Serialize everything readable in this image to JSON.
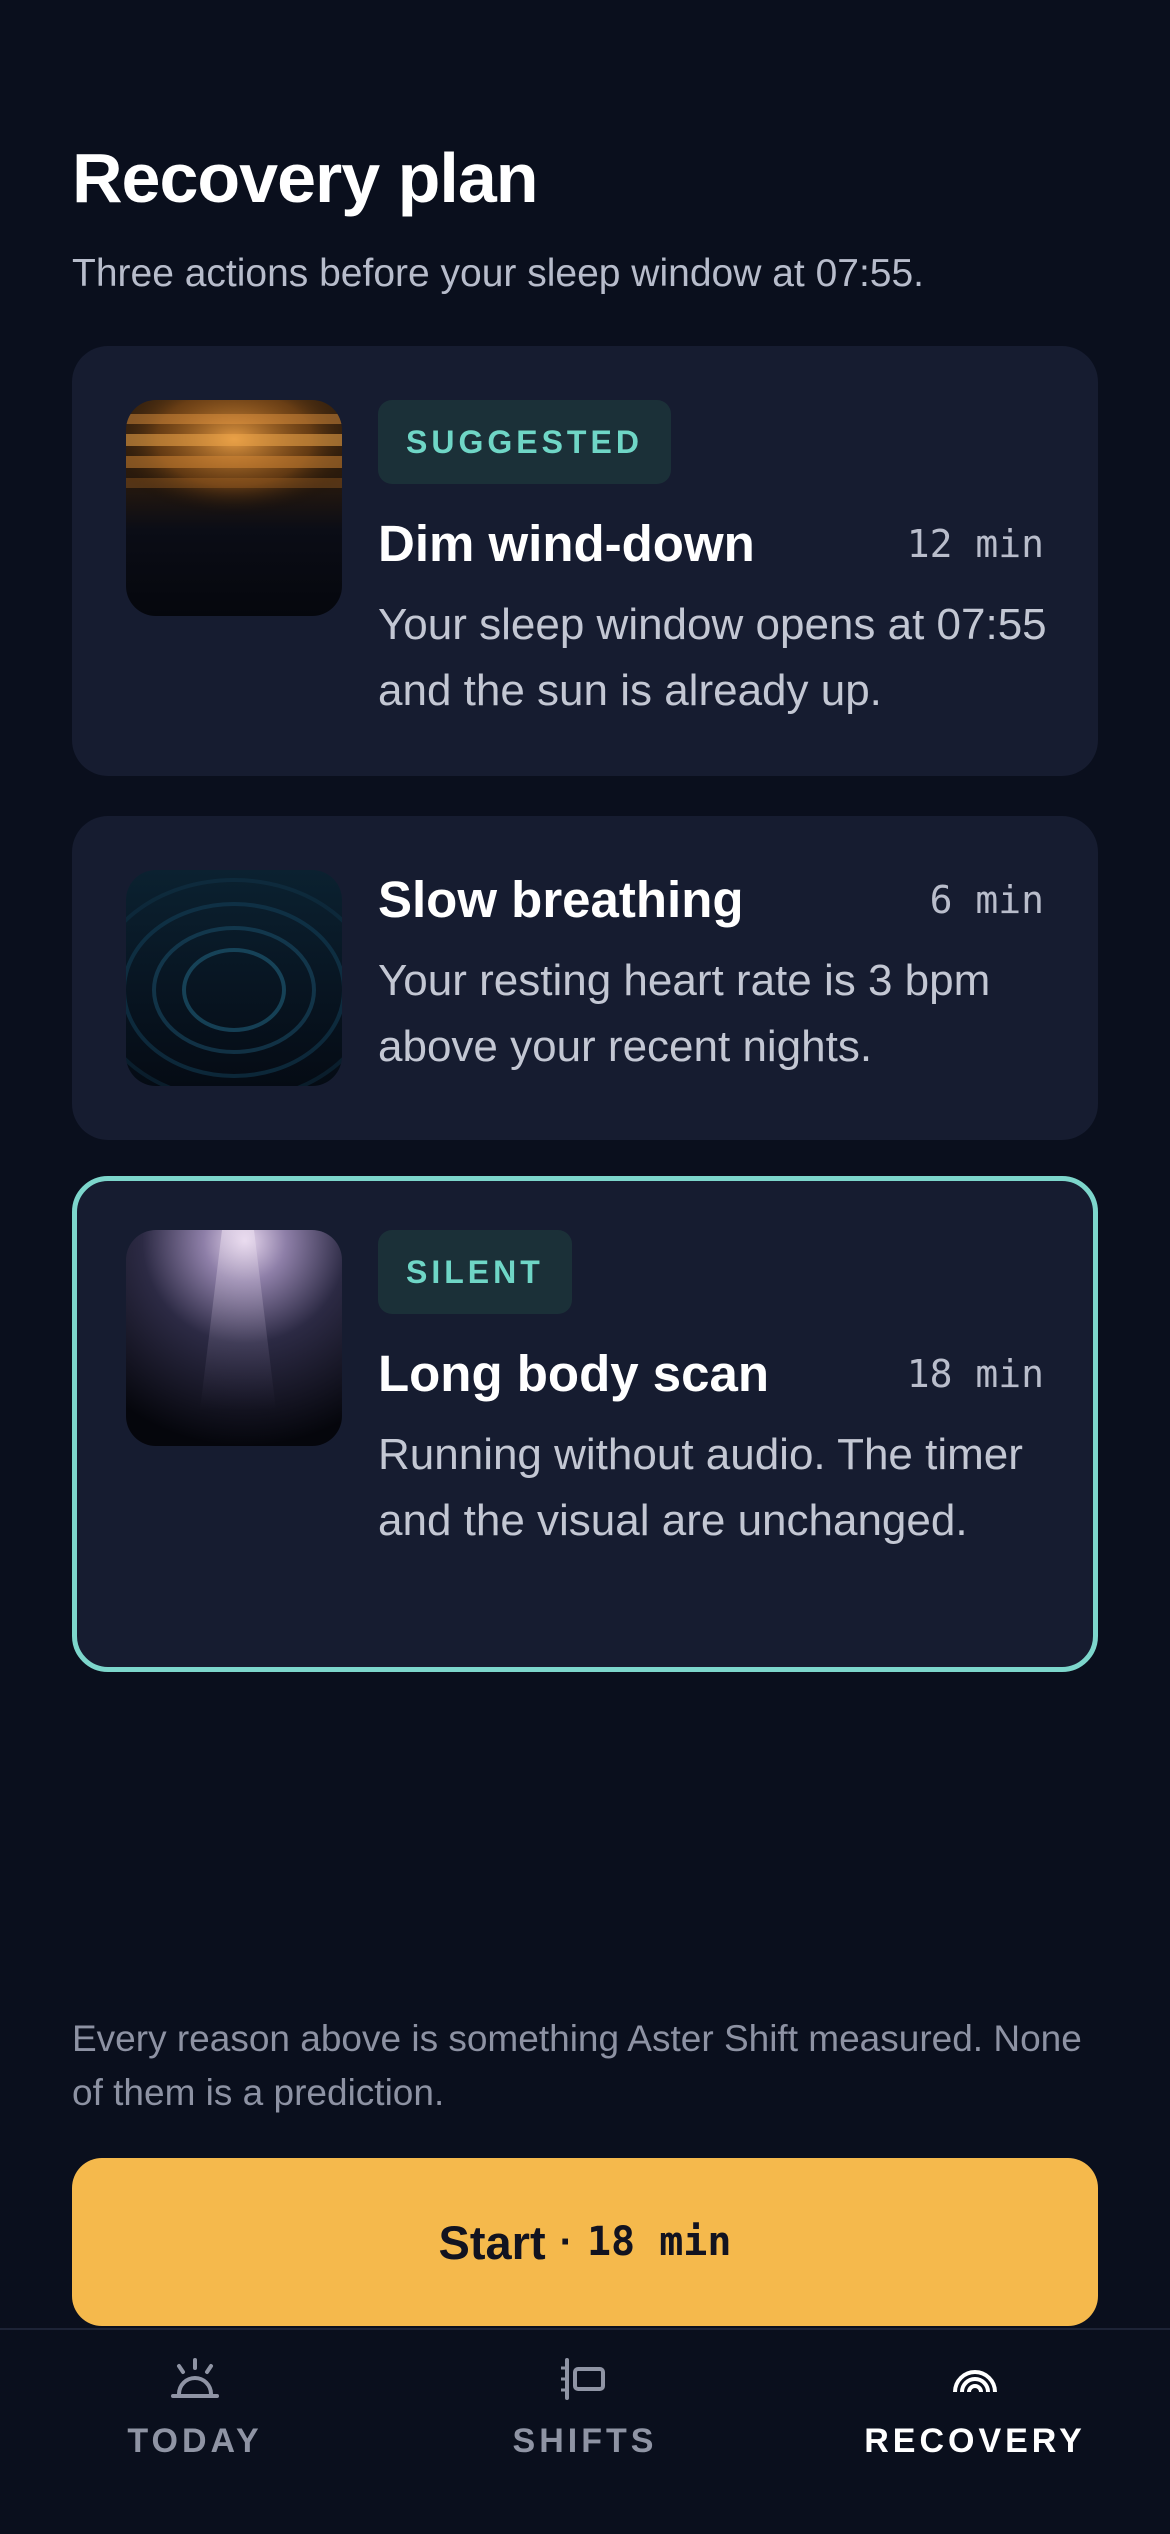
{
  "header": {
    "title": "Recovery plan",
    "subtitle": "Three actions before your sleep window at 07:55."
  },
  "cards": [
    {
      "badge": "SUGGESTED",
      "title": "Dim wind-down",
      "duration": "12 min",
      "description": "Your sleep window opens at 07:55 and the sun is already up.",
      "thumb_icon": "dim-light-thumbnail"
    },
    {
      "title": "Slow breathing",
      "duration": "6 min",
      "description": "Your resting heart rate is 3 bpm above your recent nights.",
      "thumb_icon": "breathing-ripple-thumbnail"
    },
    {
      "badge": "SILENT",
      "title": "Long body scan",
      "duration": "18 min",
      "description": "Running without audio. The timer and the visual are unchanged.",
      "thumb_icon": "light-beam-thumbnail",
      "selected": true
    }
  ],
  "footnote": "Every reason above is something Aster Shift measured. None of them is a prediction.",
  "start_button": {
    "label": "Start",
    "separator": "·",
    "duration": "18 min"
  },
  "tabs": [
    {
      "label": "TODAY",
      "icon": "sunrise-icon"
    },
    {
      "label": "SHIFTS",
      "icon": "shift-schedule-icon"
    },
    {
      "label": "RECOVERY",
      "icon": "recovery-arcs-icon",
      "active": true
    }
  ],
  "colors": {
    "background": "#0a0f1d",
    "card": "#161c30",
    "accent_teal": "#7dd6cc",
    "button_amber": "#f5b94c"
  }
}
